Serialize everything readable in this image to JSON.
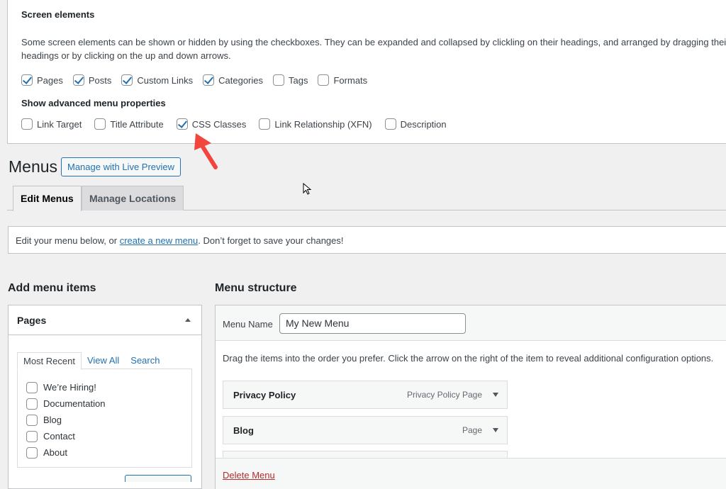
{
  "screen_options": {
    "title": "Screen elements",
    "description": "Some screen elements can be shown or hidden by using the checkboxes. They can be expanded and collapsed by clickling on their headings, and arranged by dragging their headings or by clicking on the up and down arrows.",
    "boxes": [
      {
        "label": "Pages",
        "checked": true
      },
      {
        "label": "Posts",
        "checked": true
      },
      {
        "label": "Custom Links",
        "checked": true
      },
      {
        "label": "Categories",
        "checked": true
      },
      {
        "label": "Tags",
        "checked": false
      },
      {
        "label": "Formats",
        "checked": false
      }
    ],
    "advanced_title": "Show advanced menu properties",
    "advanced": [
      {
        "label": "Link Target",
        "checked": false
      },
      {
        "label": "Title Attribute",
        "checked": false
      },
      {
        "label": "CSS Classes",
        "checked": true
      },
      {
        "label": "Link Relationship (XFN)",
        "checked": false
      },
      {
        "label": "Description",
        "checked": false
      }
    ]
  },
  "header": {
    "title": "Menus",
    "live_preview_button": "Manage with Live Preview"
  },
  "tabs": {
    "edit": "Edit Menus",
    "locations": "Manage Locations"
  },
  "notice": {
    "before": "Edit your menu below, or ",
    "link": "create a new menu",
    "after": ". Don’t forget to save your changes!"
  },
  "add_items": {
    "heading": "Add menu items",
    "pages_box": {
      "title": "Pages",
      "tabs": [
        "Most Recent",
        "View All",
        "Search"
      ],
      "items": [
        "We’re Hiring!",
        "Documentation",
        "Blog",
        "Contact",
        "About"
      ]
    }
  },
  "structure": {
    "heading": "Menu structure",
    "name_label": "Menu Name",
    "name_value": "My New Menu",
    "instructions": "Drag the items into the order you prefer. Click the arrow on the right of the item to reveal additional configuration options.",
    "items": [
      {
        "title": "Privacy Policy",
        "type": "Privacy Policy Page"
      },
      {
        "title": "Blog",
        "type": "Page"
      }
    ],
    "delete_label": "Delete Menu"
  },
  "colors": {
    "accent": "#2271b1",
    "danger": "#b32d2e",
    "annotation": "#f2463d"
  }
}
